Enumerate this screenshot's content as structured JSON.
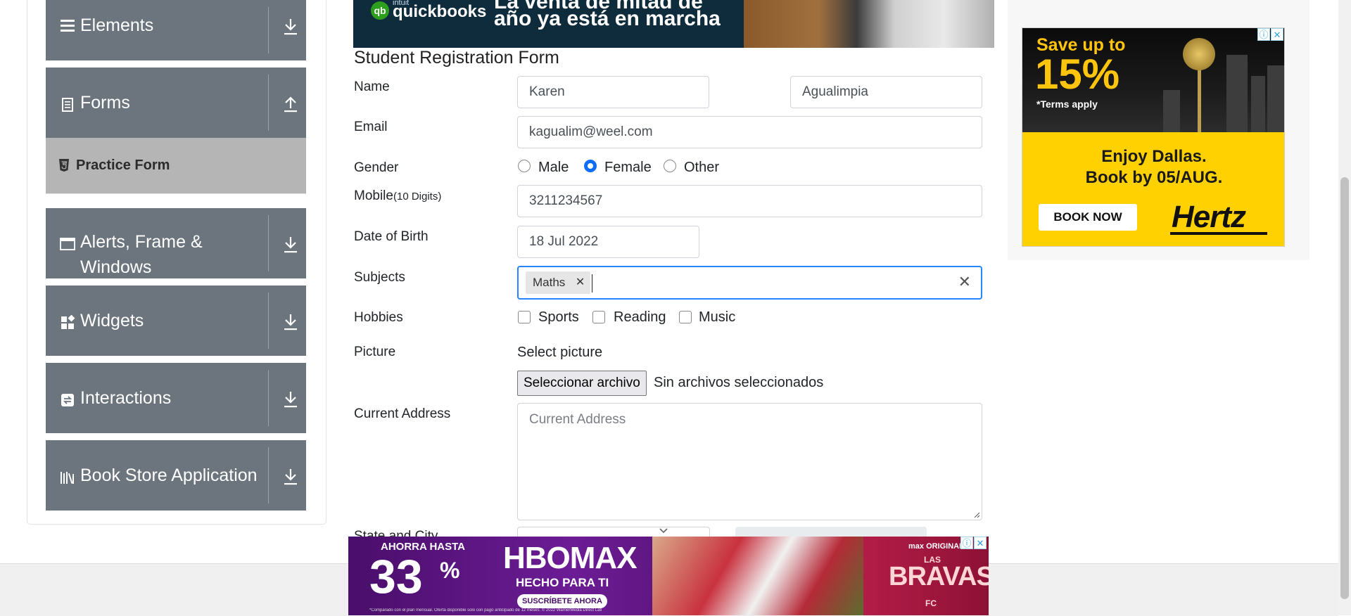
{
  "sidebar": {
    "groups": [
      {
        "label": "Elements",
        "icon": "hamburger-icon",
        "arrow": "download-icon"
      },
      {
        "label": "Forms",
        "icon": "form-doc-icon",
        "arrow": "upload-icon"
      },
      {
        "label": "Alerts, Frame &",
        "label2": "Windows",
        "icon": "window-icon",
        "arrow": "download-icon"
      },
      {
        "label": "Widgets",
        "icon": "widgets-icon",
        "arrow": "download-icon"
      },
      {
        "label": "Interactions",
        "icon": "interactions-icon",
        "arrow": "download-icon"
      },
      {
        "label": "Book Store Application",
        "icon": "books-icon",
        "arrow": "download-icon"
      }
    ],
    "active_item": "Practice Form"
  },
  "top_ad": {
    "brand_intuit": "intuit",
    "brand": "quickbooks",
    "line1": "La venta de mitad de",
    "line2": "año ya está en marcha"
  },
  "form": {
    "title": "Student Registration Form",
    "name_label": "Name",
    "first_name": "Karen",
    "last_name": "Agualimpia",
    "email_label": "Email",
    "email": "kagualim@weel.com",
    "gender_label": "Gender",
    "gender_options": [
      "Male",
      "Female",
      "Other"
    ],
    "gender_selected": "Female",
    "mobile_label": "Mobile",
    "mobile_hint": "(10 Digits)",
    "mobile": "3211234567",
    "dob_label": "Date of Birth",
    "dob": "18 Jul 2022",
    "subjects_label": "Subjects",
    "subjects": [
      "Maths"
    ],
    "hobbies_label": "Hobbies",
    "hobbies": [
      "Sports",
      "Reading",
      "Music"
    ],
    "picture_label": "Picture",
    "select_picture": "Select picture",
    "file_button": "Seleccionar archivo",
    "file_status": "Sin archivos seleccionados",
    "address_label": "Current Address",
    "address_placeholder": "Current Address",
    "state_city_label": "State and City"
  },
  "right_ad": {
    "save_line": "Save up to",
    "percent": "15%",
    "terms": "*Terms apply",
    "enjoy": "Enjoy Dallas.",
    "book_by": "Book by 05/AUG.",
    "cta": "BOOK NOW",
    "brand": "Hertz"
  },
  "bottom_ad": {
    "upto": "AHORRA HASTA",
    "number": "33",
    "pct": "%",
    "brand": "HBOMAX",
    "tagline": "HECHO PARA TI",
    "cta": "SUSCRÍBETE AHORA",
    "fine_print": "*Comparado con el plan mensual. Oferta disponible solo con pago anticipado de 12 meses. © 2022 WarnerMedia Direct Latin America, LLC. Todos los derechos reservados. HBO Max se usa bajo licencia.",
    "max_original": "max ORIGINAL",
    "las": "LAS",
    "show": "BRAVAS",
    "fc": "FC"
  },
  "colors": {
    "sidebar_group": "#6c757d",
    "practice_active": "#b5b5b5",
    "focus_blue": "#2684ff",
    "radio_blue": "#0d6efd",
    "hertz_yellow": "#ffd100"
  }
}
